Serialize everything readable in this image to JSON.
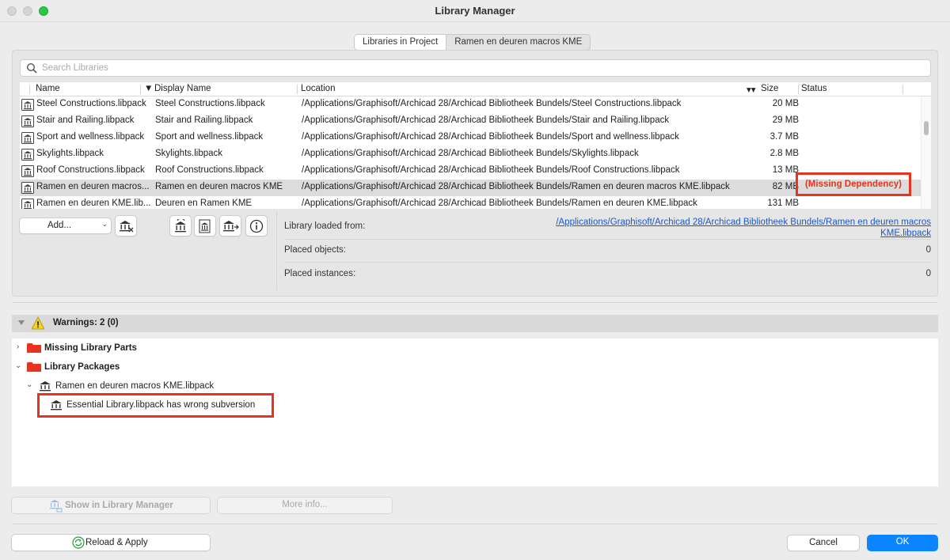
{
  "window": {
    "title": "Library Manager"
  },
  "tabs": [
    {
      "label": "Libraries in Project",
      "active": true
    },
    {
      "label": "Ramen en deuren macros KME",
      "active": false
    }
  ],
  "search": {
    "placeholder": "Search Libraries"
  },
  "table": {
    "columns": {
      "name": "Name",
      "display_name": "Display Name",
      "location": "Location",
      "size": "Size",
      "status": "Status"
    },
    "rows": [
      {
        "name": "Steel Constructions.libpack",
        "display_name": "Steel Constructions.libpack",
        "location": "/Applications/Graphisoft/Archicad 28/Archicad Bibliotheek Bundels/Steel Constructions.libpack",
        "size": "20 MB",
        "status": ""
      },
      {
        "name": "Stair and Railing.libpack",
        "display_name": "Stair and Railing.libpack",
        "location": "/Applications/Graphisoft/Archicad 28/Archicad Bibliotheek Bundels/Stair and Railing.libpack",
        "size": "29 MB",
        "status": ""
      },
      {
        "name": "Sport and wellness.libpack",
        "display_name": "Sport and wellness.libpack",
        "location": "/Applications/Graphisoft/Archicad 28/Archicad Bibliotheek Bundels/Sport and wellness.libpack",
        "size": "3.7 MB",
        "status": ""
      },
      {
        "name": "Skylights.libpack",
        "display_name": "Skylights.libpack",
        "location": "/Applications/Graphisoft/Archicad 28/Archicad Bibliotheek Bundels/Skylights.libpack",
        "size": "2.8 MB",
        "status": ""
      },
      {
        "name": "Roof Constructions.libpack",
        "display_name": "Roof Constructions.libpack",
        "location": "/Applications/Graphisoft/Archicad 28/Archicad Bibliotheek Bundels/Roof Constructions.libpack",
        "size": "13 MB",
        "status": ""
      },
      {
        "name": "Ramen en deuren macros...",
        "display_name": "Ramen en deuren macros KME",
        "location": "/Applications/Graphisoft/Archicad 28/Archicad Bibliotheek Bundels/Ramen en deuren macros KME.libpack",
        "size": "82 MB",
        "status": "(Missing Dependency)",
        "selected": true
      },
      {
        "name": "Ramen en deuren KME.lib...",
        "display_name": "Deuren en Ramen KME",
        "location": "/Applications/Graphisoft/Archicad 28/Archicad Bibliotheek Bundels/Ramen en deuren KME.libpack",
        "size": "131 MB",
        "status": ""
      }
    ]
  },
  "toolbar": {
    "add_label": "Add..."
  },
  "details": {
    "loaded_from_label": "Library loaded from:",
    "loaded_from_value": "/Applications/Graphisoft/Archicad 28/Archicad Bibliotheek Bundels/Ramen en deuren macros KME.libpack",
    "placed_objects_label": "Placed objects:",
    "placed_objects_value": "0",
    "placed_instances_label": "Placed instances:",
    "placed_instances_value": "0"
  },
  "warnings": {
    "header": "Warnings: 2 (0)",
    "missing_parts": "Missing Library Parts",
    "packages": "Library Packages",
    "package_item": "Ramen en deuren macros KME.libpack",
    "error_item": "Essential Library.libpack has wrong subversion"
  },
  "buttons": {
    "show_in_manager": "Show in Library Manager",
    "more_info": "More info...",
    "reload_apply": "Reload & Apply",
    "cancel": "Cancel",
    "ok": "OK"
  },
  "colors": {
    "accent": "#0a84ff",
    "error": "#e8341f",
    "link": "#1b58c9",
    "folder": "#e8341f"
  }
}
